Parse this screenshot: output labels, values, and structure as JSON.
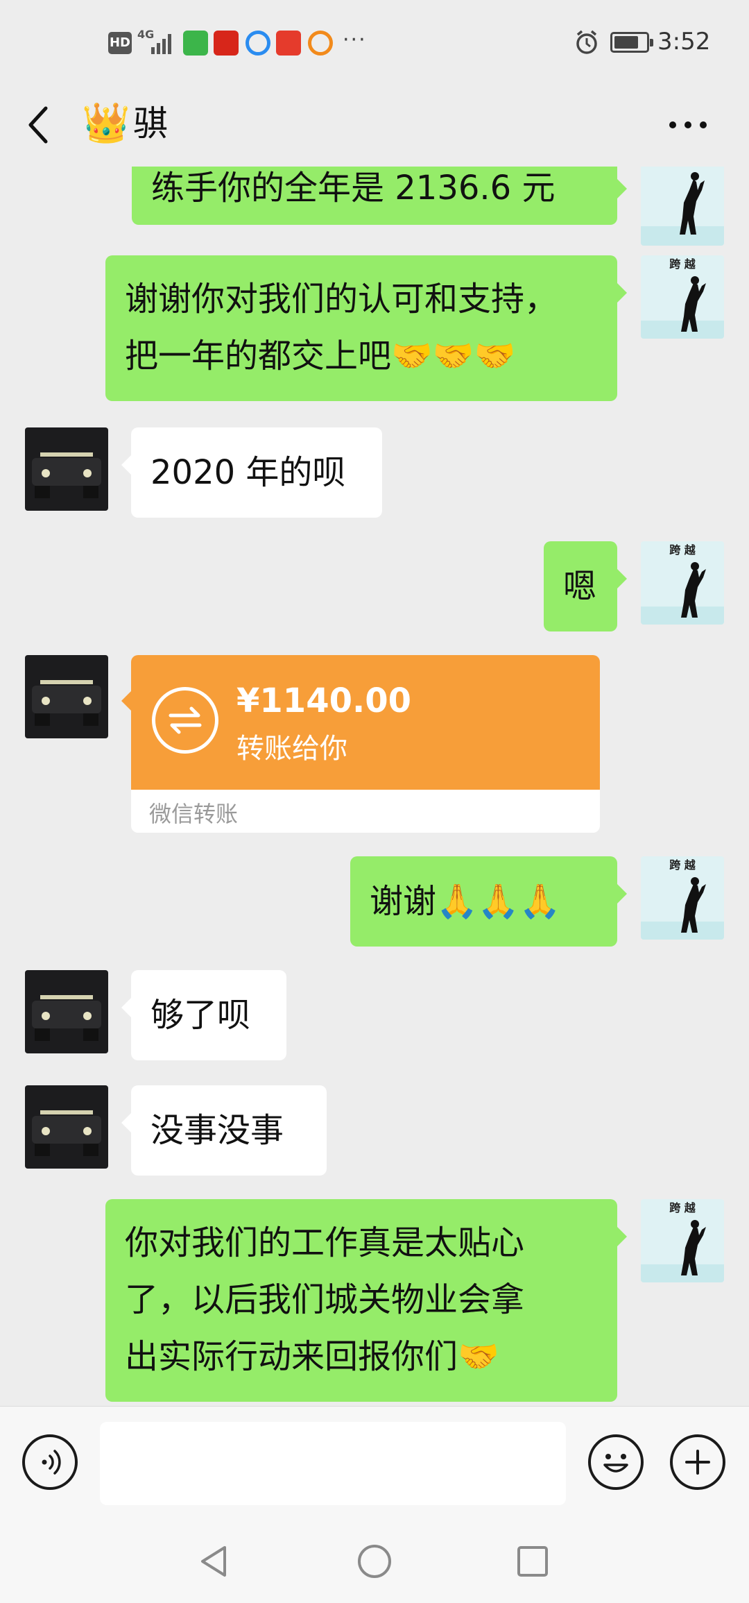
{
  "status_bar": {
    "left_badges": [
      "HD",
      "4G"
    ],
    "more": "···",
    "time": "3:52"
  },
  "header": {
    "crown_emoji": "👑",
    "title": "骐",
    "more": "···"
  },
  "messages": [
    {
      "side": "right",
      "text": "练手你的全年是 2136.6 元"
    },
    {
      "side": "right",
      "text": "谢谢你对我们的认可和支持，\n把一年的都交上吧🤝🤝🤝"
    },
    {
      "side": "left",
      "text": "2020 年的呗"
    },
    {
      "side": "right",
      "text": "嗯"
    },
    {
      "side": "left",
      "type": "transfer",
      "amount": "¥1140.00",
      "label": "转账给你",
      "footer": "微信转账"
    },
    {
      "side": "right",
      "text": "谢谢🙏🙏🙏"
    },
    {
      "side": "left",
      "text": "够了呗"
    },
    {
      "side": "left",
      "text": "没事没事"
    },
    {
      "side": "right",
      "text": "你对我们的工作真是太贴心\n了，以后我们城关物业会拿\n出实际行动来回报你们🤝"
    }
  ],
  "input": {
    "value": "",
    "placeholder": ""
  },
  "avatar_right_caption": "跨 越",
  "colors": {
    "green_bubble": "#95ec69",
    "transfer_orange": "#f79e39",
    "background": "#ededed"
  },
  "icons": {
    "back": "chevron-left-icon",
    "more": "more-dots-icon",
    "voice": "voice-icon",
    "emoji": "emoji-icon",
    "plus": "plus-icon",
    "transfer": "transfer-arrows-icon",
    "nav_back": "triangle-back-icon",
    "nav_home": "circle-home-icon",
    "nav_recent": "square-recent-icon"
  }
}
